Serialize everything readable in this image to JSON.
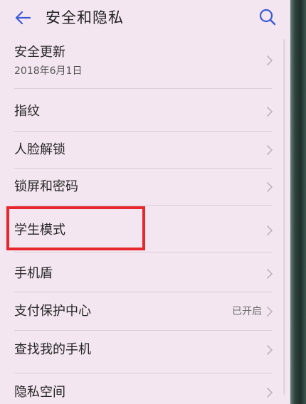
{
  "header": {
    "title": "安全和隐私",
    "back_icon": "arrow-left-icon",
    "search_icon": "search-icon"
  },
  "items": [
    {
      "label": "安全更新",
      "sub": "2018年6月1日",
      "status": ""
    },
    {
      "label": "指纹",
      "sub": "",
      "status": ""
    },
    {
      "label": "人脸解锁",
      "sub": "",
      "status": ""
    },
    {
      "label": "锁屏和密码",
      "sub": "",
      "status": ""
    },
    {
      "label": "学生模式",
      "sub": "",
      "status": ""
    },
    {
      "label": "手机盾",
      "sub": "",
      "status": ""
    },
    {
      "label": "支付保护中心",
      "sub": "",
      "status": "已开启"
    },
    {
      "label": "查找我的手机",
      "sub": "",
      "status": ""
    },
    {
      "label": "隐私空间",
      "sub": "",
      "status": ""
    }
  ],
  "colors": {
    "accent": "#3b5bd8",
    "highlight": "#e8262d",
    "background": "#f3e6f1"
  }
}
